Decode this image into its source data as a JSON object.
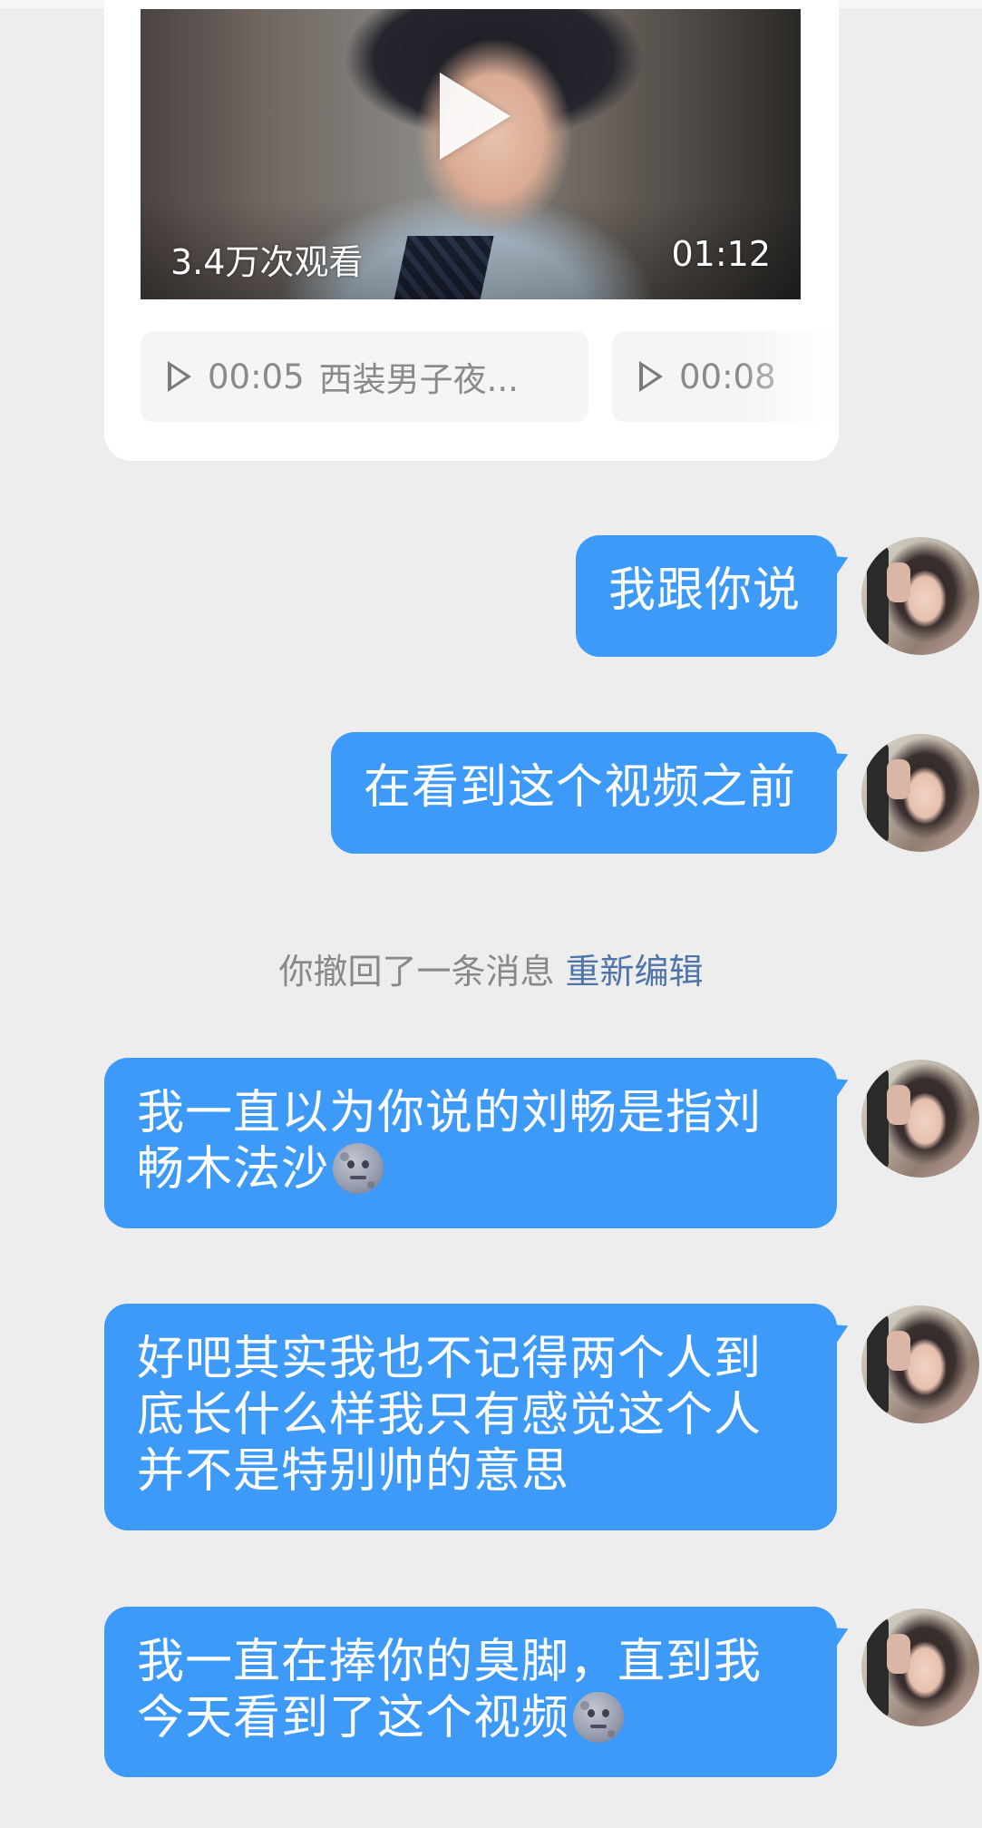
{
  "video_card": {
    "views": "3.4万次观看",
    "duration": "01:12",
    "chips": [
      {
        "time": "00:05",
        "title": "西装男子夜..."
      },
      {
        "time": "00:08",
        "title": ""
      }
    ]
  },
  "messages": [
    {
      "text": "我跟你说"
    },
    {
      "text": "在看到这个视频之前"
    },
    {
      "text": "我一直以为你说的刘畅是指刘畅木法沙",
      "emoji": "moon-face-emoji"
    },
    {
      "text_lines": [
        "好吧其实我也不记得两个人到",
        "底长什么样我只有感觉这个人",
        "并不是特别帅的意思"
      ]
    },
    {
      "text": "我一直在捧你的臭脚，直到我今天看到了这个视频",
      "emoji": "moon-face-emoji"
    }
  ],
  "system": {
    "recall_text": "你撤回了一条消息",
    "reedit_link": "重新编辑"
  },
  "colors": {
    "bubble": "#3d9af8",
    "background": "#ededed",
    "link": "#4f74a8"
  }
}
